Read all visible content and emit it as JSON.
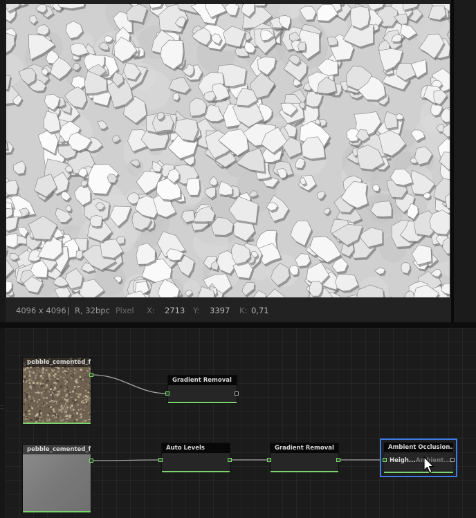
{
  "viewer": {
    "resolution": "4096 x 4096",
    "separator": "|",
    "format": "R, 32bpc",
    "pixel_label": "Pixel",
    "x_label": "X:",
    "x_value": "2713",
    "y_label": "Y:",
    "y_value": "3397",
    "k_label": "K:",
    "k_value": "0,71"
  },
  "graph": {
    "nodes": {
      "source_color": {
        "title": "pebble_cemented_flo"
      },
      "source_height": {
        "title": "pebble_cemented_flo"
      },
      "gradient_removal_1": {
        "title": "Gradient Removal"
      },
      "auto_levels": {
        "title": "Auto Levels"
      },
      "gradient_removal_2": {
        "title": "Gradient Removal"
      },
      "ambient_occlusion": {
        "title": "Ambient Occlusion...",
        "input_label": "Heigh...",
        "output_label": "Ambient..."
      }
    }
  },
  "colors": {
    "accent_selection": "#3d7ae5",
    "port_green": "#7dd46f"
  }
}
